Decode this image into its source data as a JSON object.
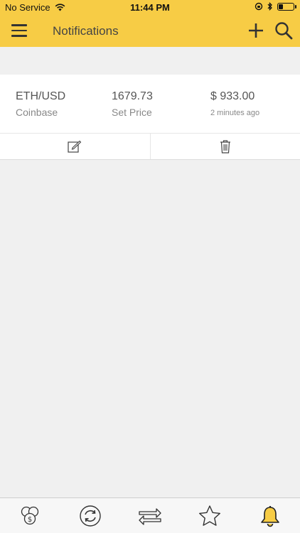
{
  "status_bar": {
    "carrier": "No Service",
    "time": "11:44 PM",
    "battery_level": 0.25
  },
  "header": {
    "title": "Notifications",
    "background_color": "#f7cc45",
    "menu_icon": "hamburger-menu-icon",
    "add_icon": "plus-icon",
    "search_icon": "search-icon"
  },
  "alerts": [
    {
      "pair": "ETH/USD",
      "exchange": "Coinbase",
      "price": "1679.73",
      "price_label": "Set Price",
      "amount": "$ 933.00",
      "time_ago": "2 minutes ago",
      "edit_icon": "edit-icon",
      "delete_icon": "trash-icon"
    }
  ],
  "tab_bar": {
    "tabs": [
      {
        "icon": "coins-icon",
        "active": false
      },
      {
        "icon": "refresh-icon",
        "active": false
      },
      {
        "icon": "exchange-arrows-icon",
        "active": false
      },
      {
        "icon": "star-icon",
        "active": false
      },
      {
        "icon": "bell-icon",
        "active": true
      }
    ],
    "active_color": "#f7cc45"
  }
}
